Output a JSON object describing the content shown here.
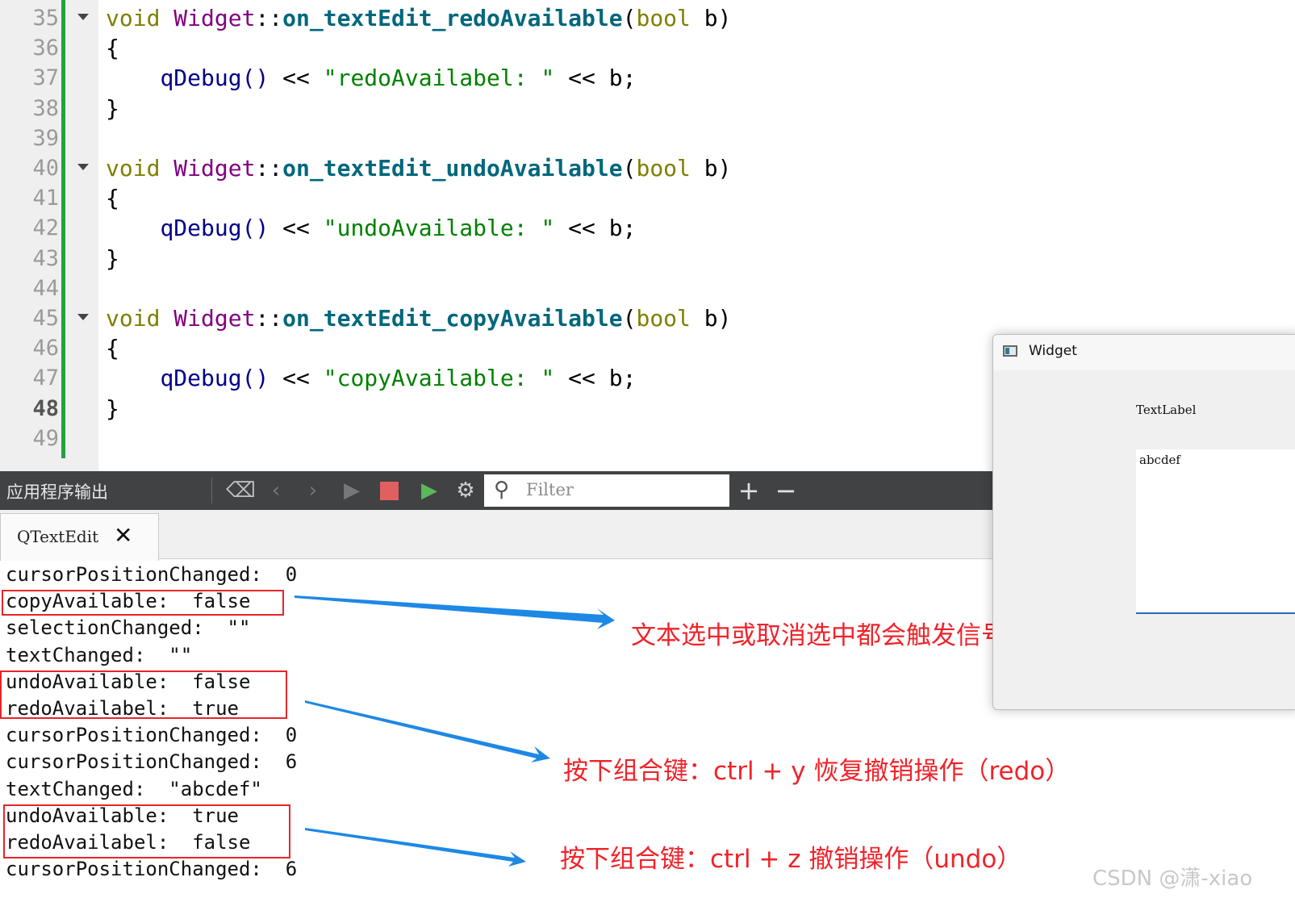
{
  "editor": {
    "line_numbers": [
      "35",
      "36",
      "37",
      "38",
      "39",
      "40",
      "41",
      "42",
      "43",
      "44",
      "45",
      "46",
      "47",
      "48",
      "49"
    ],
    "current_line": "48",
    "functions": [
      {
        "ret": "void",
        "cls": "Widget",
        "sep": "::",
        "name": "on_textEdit_redoAvailable",
        "open": "(",
        "ptype": "bool",
        "pname": " b)",
        "brace_open": "{",
        "call": "qDebug()",
        "op1": " << ",
        "str": "\"redoAvailabel: \"",
        "op2": " << ",
        "tail": "b;",
        "brace_close": "}"
      },
      {
        "ret": "void",
        "cls": "Widget",
        "sep": "::",
        "name": "on_textEdit_undoAvailable",
        "open": "(",
        "ptype": "bool",
        "pname": " b)",
        "brace_open": "{",
        "call": "qDebug()",
        "op1": " << ",
        "str": "\"undoAvailable: \"",
        "op2": " << ",
        "tail": "b;",
        "brace_close": "}"
      },
      {
        "ret": "void",
        "cls": "Widget",
        "sep": "::",
        "name": "on_textEdit_copyAvailable",
        "open": "(",
        "ptype": "bool",
        "pname": " b)",
        "brace_open": "{",
        "call": "qDebug()",
        "op1": " << ",
        "str": "\"copyAvailable: \"",
        "op2": " << ",
        "tail": "b;",
        "brace_close": "}"
      }
    ]
  },
  "output_pane": {
    "title": "应用程序输出",
    "filter_placeholder": "Filter",
    "tab_label": "QTextEdit",
    "tab_close": "✕",
    "add_label": "+",
    "remove_label": "−",
    "lines": [
      "cursorPositionChanged:  0",
      "copyAvailable:  false",
      "selectionChanged:  \"\"",
      "textChanged:  \"\"",
      "undoAvailable:  false",
      "redoAvailabel:  true",
      "cursorPositionChanged:  0",
      "cursorPositionChanged:  6",
      "textChanged:  \"abcdef\"",
      "undoAvailable:  true",
      "redoAvailabel:  false",
      "cursorPositionChanged:  6"
    ]
  },
  "annotations": [
    "文本选中或取消选中都会触发信号",
    "按下组合键：ctrl + y 恢复撤销操作（redo）",
    "按下组合键：ctrl + z 撤销操作（undo）"
  ],
  "widget_window": {
    "title": "Widget",
    "label": "TextLabel",
    "edit_text": "abcdef"
  },
  "watermark": "CSDN @潇-xiao",
  "colors": {
    "annotation_red": "#f0232a",
    "arrow_blue": "#1e88e5",
    "gutter_green": "#22a33a"
  }
}
